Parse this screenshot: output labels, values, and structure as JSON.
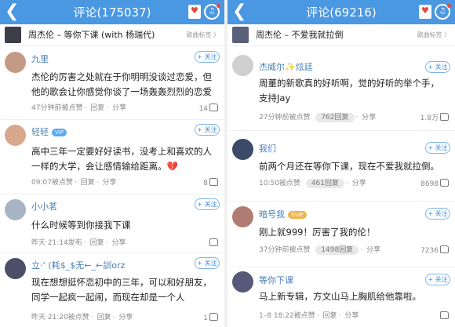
{
  "colors": {
    "accent": "#4a97e2",
    "name": "#4a7fb5",
    "follow": "#3d8be0",
    "heart": "#e8463f"
  },
  "left": {
    "title": "评论(175037)",
    "song": "周杰伦 – 等你下课 (with 杨瑞代)",
    "tag_btn": "歌曲标签 〉",
    "comments": [
      {
        "name": "九里",
        "text": "杰伦的厉害之处就在于你明明没谈过恋爱，但他的歌会让你感觉你谈了一场轰轰烈烈的恋爱",
        "time": "47分钟前被点赞",
        "reply": "回复",
        "share": "分享",
        "likes": "14",
        "follow": "+ 关注"
      },
      {
        "name": "轻轻",
        "badge": "VIP",
        "text": "高中三年一定要好好读书，没考上和喜欢的人一样的大学，会让感情输给距离。💔",
        "time": "09:07被点赞",
        "reply": "回复",
        "share": "分享",
        "likes": "8",
        "follow": "+ 关注"
      },
      {
        "name": "小小茗",
        "text": "什么时候等到你接我下课",
        "time": "昨天 21:14发布",
        "reply": "回复",
        "share": "分享",
        "likes": "",
        "follow": "+ 关注"
      },
      {
        "name": "立·‘ (耗$_$无←_←訓orz",
        "text": "现在想想挺怀恋初中的三年，可以和好朋友，同学一起疯一起闹，而现在却是一个人",
        "time": "昨天 21:20被点赞",
        "reply": "回复",
        "share": "分享",
        "likes": "1",
        "follow": "+ 关注"
      }
    ]
  },
  "right": {
    "title": "评论(69216)",
    "song": "周杰伦 – 不爱我就拉倒",
    "tag_btn": "歌曲标签 〉",
    "comments": [
      {
        "name": "杰威尔✨炫廷",
        "text": "周董的新歌真的好听啊，觉的好听的举个手，支持Jay",
        "time": "27分钟前被点赞",
        "chip": "762回复",
        "share": "分享",
        "likes": "1.8万",
        "follow": "+ 关注"
      },
      {
        "name": "我们",
        "text": "前两个月还在等你下课，现在不爱我就拉倒。",
        "time": "10:50被点赞",
        "chip": "461回复",
        "share": "分享",
        "likes": "8698",
        "follow": "+ 关注"
      },
      {
        "name": "暗号我",
        "badge": "SVIP",
        "text": "刚上就999！厉害了我的伦！",
        "time": "37分钟前被点赞",
        "chip": "1498回复",
        "share": "分享",
        "likes": "7236",
        "follow": "+ 关注"
      },
      {
        "name": "等你下课",
        "text": "马上新专辑，方文山马上胸肌给他靠啦。",
        "time": "1–8 18:22被点赞",
        "reply": "回复",
        "share": "分享",
        "likes": "",
        "follow": "+ 关注"
      }
    ]
  }
}
